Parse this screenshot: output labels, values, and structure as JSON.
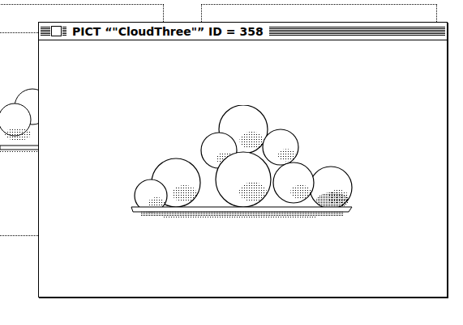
{
  "window": {
    "title": "PICT “\"CloudThree\"” ID = 358",
    "active": true
  }
}
